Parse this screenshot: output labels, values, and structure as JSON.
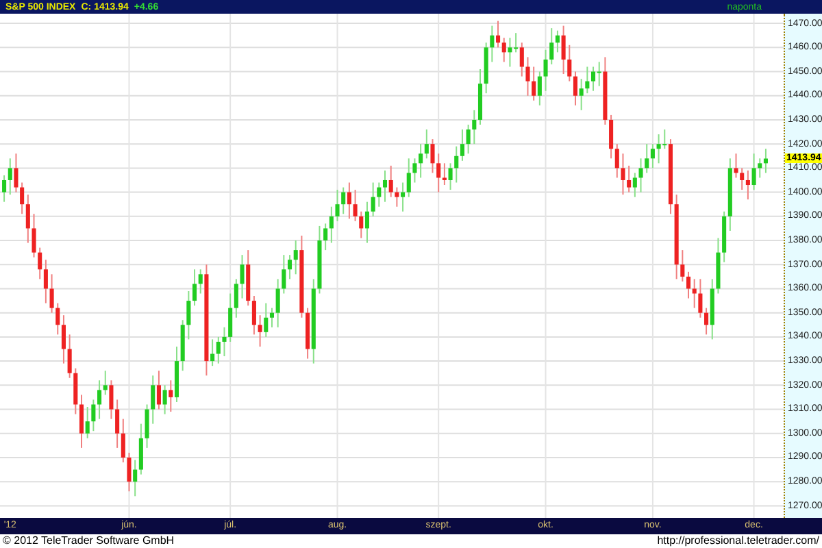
{
  "header": {
    "instrument": "S&P 500 INDEX",
    "close": "C: 1413.94",
    "change": "+4.66",
    "interval": "naponta"
  },
  "chart": {
    "last_price": "1413.94",
    "chart_data": {
      "type": "candlestick",
      "ylim": [
        1265,
        1474
      ],
      "grid": true,
      "categories": [
        null,
        "'12",
        null,
        null,
        null,
        null,
        null,
        null,
        null,
        null,
        null,
        null,
        null,
        null,
        null,
        null,
        null,
        null,
        null,
        null,
        null,
        "jún.",
        null,
        null,
        null,
        null,
        null,
        null,
        null,
        null,
        null,
        null,
        null,
        null,
        null,
        null,
        null,
        null,
        "júl.",
        null,
        null,
        null,
        null,
        null,
        null,
        null,
        null,
        null,
        null,
        null,
        null,
        null,
        null,
        null,
        null,
        null,
        "aug.",
        null,
        null,
        null,
        null,
        null,
        null,
        null,
        null,
        null,
        null,
        null,
        null,
        null,
        null,
        null,
        null,
        "szept.",
        null,
        null,
        null,
        null,
        null,
        null,
        null,
        null,
        null,
        null,
        null,
        null,
        null,
        null,
        null,
        null,
        null,
        "okt.",
        null,
        null,
        null,
        null,
        null,
        null,
        null,
        null,
        null,
        null,
        null,
        null,
        null,
        null,
        null,
        null,
        null,
        "nov.",
        null,
        null,
        null,
        null,
        null,
        null,
        null,
        null,
        null,
        null,
        null,
        null,
        null,
        null,
        null,
        null,
        "dec.",
        null,
        null
      ],
      "ohlc": [
        [
          1400,
          1407,
          1396,
          1405
        ],
        [
          1405,
          1414,
          1399,
          1410
        ],
        [
          1410,
          1416,
          1400,
          1402
        ],
        [
          1402,
          1404,
          1391,
          1395
        ],
        [
          1395,
          1399,
          1379,
          1385
        ],
        [
          1385,
          1391,
          1373,
          1375
        ],
        [
          1375,
          1377,
          1364,
          1368
        ],
        [
          1368,
          1372,
          1354,
          1360
        ],
        [
          1360,
          1366,
          1350,
          1352
        ],
        [
          1352,
          1354,
          1341,
          1345
        ],
        [
          1345,
          1349,
          1329,
          1335
        ],
        [
          1335,
          1341,
          1323,
          1325
        ],
        [
          1325,
          1327,
          1308,
          1312
        ],
        [
          1312,
          1316,
          1294,
          1300
        ],
        [
          1300,
          1311,
          1298,
          1305
        ],
        [
          1305,
          1314,
          1301,
          1312
        ],
        [
          1312,
          1322,
          1306,
          1318
        ],
        [
          1318,
          1326,
          1316,
          1320
        ],
        [
          1320,
          1322,
          1306,
          1310
        ],
        [
          1310,
          1314,
          1294,
          1300
        ],
        [
          1300,
          1306,
          1288,
          1290
        ],
        [
          1290,
          1292,
          1276,
          1280
        ],
        [
          1280,
          1289,
          1274,
          1285
        ],
        [
          1285,
          1304,
          1283,
          1298
        ],
        [
          1298,
          1312,
          1294,
          1310
        ],
        [
          1310,
          1324,
          1304,
          1320
        ],
        [
          1320,
          1326,
          1310,
          1312
        ],
        [
          1312,
          1320,
          1308,
          1318
        ],
        [
          1318,
          1322,
          1309,
          1315
        ],
        [
          1315,
          1336,
          1313,
          1330
        ],
        [
          1330,
          1347,
          1326,
          1345
        ],
        [
          1345,
          1359,
          1339,
          1355
        ],
        [
          1355,
          1368,
          1353,
          1362
        ],
        [
          1362,
          1368,
          1358,
          1366
        ],
        [
          1366,
          1370,
          1324,
          1330
        ],
        [
          1330,
          1339,
          1328,
          1333
        ],
        [
          1333,
          1340,
          1329,
          1338
        ],
        [
          1338,
          1344,
          1332,
          1340
        ],
        [
          1340,
          1358,
          1338,
          1352
        ],
        [
          1352,
          1364,
          1348,
          1362
        ],
        [
          1362,
          1374,
          1356,
          1370
        ],
        [
          1370,
          1376,
          1353,
          1355
        ],
        [
          1355,
          1357,
          1341,
          1345
        ],
        [
          1345,
          1349,
          1336,
          1342
        ],
        [
          1342,
          1354,
          1340,
          1348
        ],
        [
          1348,
          1352,
          1344,
          1350
        ],
        [
          1350,
          1364,
          1344,
          1360
        ],
        [
          1360,
          1374,
          1358,
          1368
        ],
        [
          1368,
          1374,
          1364,
          1372
        ],
        [
          1372,
          1380,
          1366,
          1376
        ],
        [
          1376,
          1382,
          1348,
          1350
        ],
        [
          1350,
          1352,
          1331,
          1335
        ],
        [
          1335,
          1364,
          1329,
          1360
        ],
        [
          1360,
          1386,
          1358,
          1380
        ],
        [
          1380,
          1387,
          1376,
          1385
        ],
        [
          1385,
          1394,
          1379,
          1390
        ],
        [
          1390,
          1401,
          1388,
          1395
        ],
        [
          1395,
          1402,
          1391,
          1400
        ],
        [
          1400,
          1404,
          1389,
          1395
        ],
        [
          1395,
          1401,
          1388,
          1390
        ],
        [
          1390,
          1392,
          1381,
          1385
        ],
        [
          1385,
          1396,
          1379,
          1392
        ],
        [
          1392,
          1404,
          1390,
          1398
        ],
        [
          1398,
          1404,
          1394,
          1402
        ],
        [
          1402,
          1409,
          1396,
          1405
        ],
        [
          1405,
          1411,
          1398,
          1400
        ],
        [
          1400,
          1402,
          1394,
          1398
        ],
        [
          1398,
          1404,
          1392,
          1400
        ],
        [
          1400,
          1414,
          1398,
          1408
        ],
        [
          1408,
          1414,
          1404,
          1412
        ],
        [
          1412,
          1420,
          1406,
          1416
        ],
        [
          1416,
          1426,
          1414,
          1420
        ],
        [
          1420,
          1422,
          1408,
          1412
        ],
        [
          1412,
          1416,
          1400,
          1406
        ],
        [
          1406,
          1412,
          1403,
          1405
        ],
        [
          1405,
          1412,
          1401,
          1410
        ],
        [
          1410,
          1419,
          1404,
          1415
        ],
        [
          1415,
          1426,
          1413,
          1420
        ],
        [
          1420,
          1428,
          1416,
          1426
        ],
        [
          1426,
          1434,
          1420,
          1430
        ],
        [
          1430,
          1451,
          1428,
          1445
        ],
        [
          1445,
          1462,
          1441,
          1460
        ],
        [
          1460,
          1469,
          1454,
          1465
        ],
        [
          1465,
          1471,
          1460,
          1462
        ],
        [
          1462,
          1464,
          1454,
          1458
        ],
        [
          1458,
          1464,
          1452,
          1460
        ],
        [
          1460,
          1466,
          1458,
          1460
        ],
        [
          1460,
          1462,
          1448,
          1452
        ],
        [
          1452,
          1456,
          1440,
          1446
        ],
        [
          1446,
          1452,
          1438,
          1440
        ],
        [
          1440,
          1450,
          1436,
          1448
        ],
        [
          1448,
          1459,
          1442,
          1455
        ],
        [
          1455,
          1468,
          1453,
          1462
        ],
        [
          1462,
          1467,
          1458,
          1465
        ],
        [
          1465,
          1469,
          1449,
          1455
        ],
        [
          1455,
          1461,
          1446,
          1448
        ],
        [
          1448,
          1450,
          1436,
          1440
        ],
        [
          1440,
          1447,
          1434,
          1443
        ],
        [
          1443,
          1452,
          1441,
          1446
        ],
        [
          1446,
          1452,
          1442,
          1450
        ],
        [
          1450,
          1454,
          1444,
          1450
        ],
        [
          1450,
          1456,
          1428,
          1430
        ],
        [
          1430,
          1432,
          1414,
          1418
        ],
        [
          1418,
          1420,
          1406,
          1410
        ],
        [
          1410,
          1416,
          1399,
          1405
        ],
        [
          1405,
          1411,
          1400,
          1402
        ],
        [
          1402,
          1408,
          1398,
          1406
        ],
        [
          1406,
          1414,
          1400,
          1410
        ],
        [
          1410,
          1420,
          1408,
          1414
        ],
        [
          1414,
          1420,
          1410,
          1418
        ],
        [
          1418,
          1424,
          1412,
          1420
        ],
        [
          1420,
          1426,
          1418,
          1420
        ],
        [
          1420,
          1422,
          1391,
          1395
        ],
        [
          1395,
          1399,
          1364,
          1370
        ],
        [
          1370,
          1376,
          1363,
          1365
        ],
        [
          1365,
          1367,
          1356,
          1360
        ],
        [
          1360,
          1364,
          1352,
          1358
        ],
        [
          1358,
          1364,
          1348,
          1350
        ],
        [
          1350,
          1352,
          1341,
          1345
        ],
        [
          1345,
          1364,
          1339,
          1360
        ],
        [
          1360,
          1381,
          1358,
          1375
        ],
        [
          1375,
          1392,
          1371,
          1390
        ],
        [
          1390,
          1414,
          1384,
          1410
        ],
        [
          1410,
          1416,
          1406,
          1408
        ],
        [
          1408,
          1410,
          1401,
          1405
        ],
        [
          1405,
          1409,
          1397,
          1403
        ],
        [
          1403,
          1416,
          1401,
          1410
        ],
        [
          1410,
          1414,
          1406,
          1412
        ],
        [
          1412,
          1418,
          1408,
          1413.94
        ]
      ],
      "yticks": [
        {
          "value": 1470,
          "label": "1470.00"
        },
        {
          "value": 1460,
          "label": "1460.00"
        },
        {
          "value": 1450,
          "label": "1450.00"
        },
        {
          "value": 1440,
          "label": "1440.00"
        },
        {
          "value": 1430,
          "label": "1430.00"
        },
        {
          "value": 1420,
          "label": "1420.00"
        },
        {
          "value": 1410,
          "label": "1410.00"
        },
        {
          "value": 1400,
          "label": "1400.00"
        },
        {
          "value": 1390,
          "label": "1390.00"
        },
        {
          "value": 1380,
          "label": "1380.00"
        },
        {
          "value": 1370,
          "label": "1370.00"
        },
        {
          "value": 1360,
          "label": "1360.00"
        },
        {
          "value": 1350,
          "label": "1350.00"
        },
        {
          "value": 1340,
          "label": "1340.00"
        },
        {
          "value": 1330,
          "label": "1330.00"
        },
        {
          "value": 1320,
          "label": "1320.00"
        },
        {
          "value": 1310,
          "label": "1310.00"
        },
        {
          "value": 1300,
          "label": "1300.00"
        },
        {
          "value": 1290,
          "label": "1290.00"
        },
        {
          "value": 1280,
          "label": "1280.00"
        },
        {
          "value": 1270,
          "label": "1270.00"
        }
      ]
    }
  },
  "footer": {
    "copyright": "© 2012 TeleTrader Software GmbH",
    "url": "http://professional.teletrader.com/"
  }
}
